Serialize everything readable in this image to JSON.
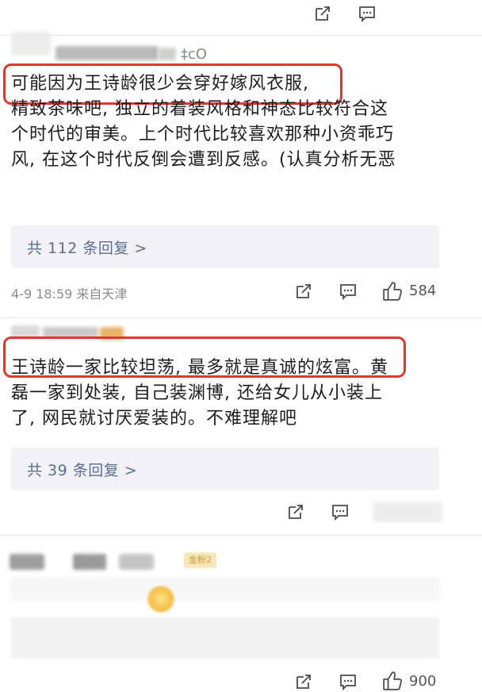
{
  "comments": [
    {
      "handle_fragment": "‡cO",
      "lines": [
        "可能因为王诗龄很少会穿好嫁风衣服,",
        "精致茶味吧, 独立的着装风格和神态比较符合这",
        "个时代的审美。上个时代比较喜欢那种小资乖巧",
        "风, 在这个时代反倒会遭到反感。(认真分析无恶"
      ],
      "replies_label": "共 112 条回复 >",
      "timestamp": "4-9 18:59 来自天津",
      "likes": "584"
    },
    {
      "lines": [
        "王诗龄一家比较坦荡, 最多就是真诚的炫富。黄",
        "磊一家到处装, 自己装渊博, 还给女儿从小装上",
        "了, 网民就讨厌爱装的。不难理解吧"
      ],
      "replies_label": "共 39 条回复 >"
    },
    {
      "fan_badge": "金粉2",
      "likes": "900"
    }
  ],
  "icons": {
    "share": "share-icon",
    "comment": "comment-icon",
    "like": "thumbs-up-icon"
  },
  "colors": {
    "highlight": "#e0382c",
    "link": "#5b6d97",
    "reply_bg": "#f2f2f4"
  }
}
